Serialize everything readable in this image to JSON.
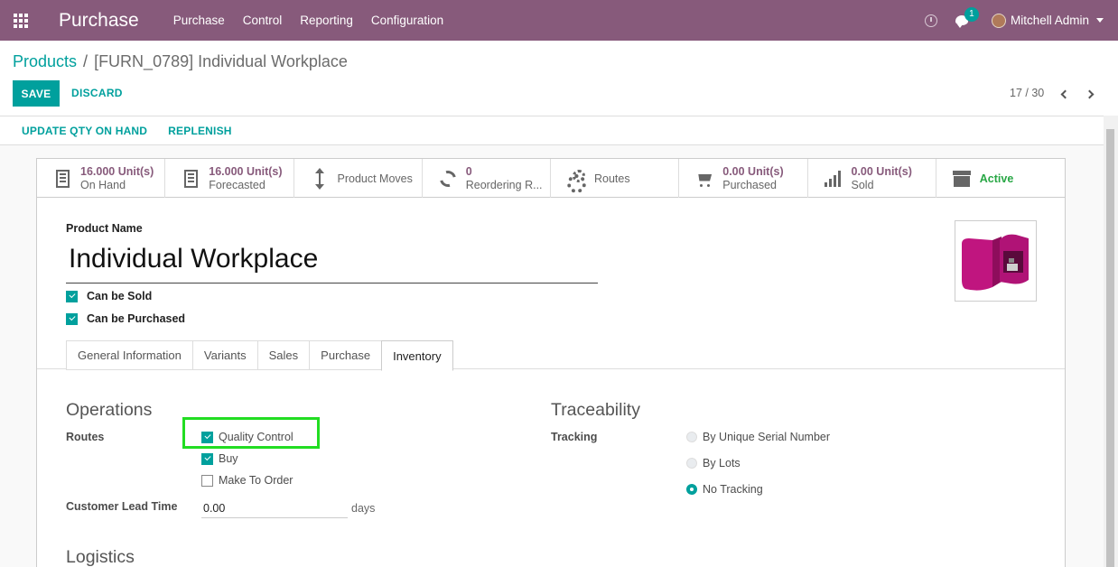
{
  "navbar": {
    "app_name": "Purchase",
    "menu": [
      "Purchase",
      "Control",
      "Reporting",
      "Configuration"
    ],
    "chat_count": "1",
    "user_name": "Mitchell Admin",
    "bg_color": "#875a7b"
  },
  "breadcrumb": {
    "parent": "Products",
    "separator": "/",
    "current": "[FURN_0789] Individual Workplace"
  },
  "actions": {
    "save": "SAVE",
    "discard": "DISCARD"
  },
  "pager": {
    "value": "17 / 30"
  },
  "header_buttons": {
    "update_qty": "UPDATE QTY ON HAND",
    "replenish": "REPLENISH"
  },
  "smart_buttons": {
    "on_hand": {
      "value": "16.000 Unit(s)",
      "label": "On Hand",
      "icon": "building-icon"
    },
    "forecasted": {
      "value": "16.000 Unit(s)",
      "label": "Forecasted",
      "icon": "building-icon"
    },
    "moves": {
      "label": "Product Moves",
      "icon": "arrows-v-icon"
    },
    "reordering": {
      "value": "0",
      "label": "Reordering R...",
      "icon": "refresh-icon"
    },
    "routes": {
      "label": "Routes",
      "icon": "gears-icon"
    },
    "purchased": {
      "value": "0.00 Unit(s)",
      "label": "Purchased",
      "icon": "cart-icon"
    },
    "sold": {
      "value": "0.00 Unit(s)",
      "label": "Sold",
      "icon": "signal-icon"
    },
    "active": {
      "label": "Active",
      "icon": "archive-icon"
    }
  },
  "product": {
    "name_label": "Product Name",
    "name": "Individual Workplace",
    "can_be_sold_label": "Can be Sold",
    "can_be_sold": true,
    "can_be_purchased_label": "Can be Purchased",
    "can_be_purchased": true
  },
  "tabs": [
    "General Information",
    "Variants",
    "Sales",
    "Purchase",
    "Inventory"
  ],
  "active_tab": "Inventory",
  "inventory": {
    "operations_title": "Operations",
    "routes_label": "Routes",
    "routes": [
      {
        "label": "Quality Control",
        "checked": true
      },
      {
        "label": "Buy",
        "checked": true
      },
      {
        "label": "Make To Order",
        "checked": false
      }
    ],
    "lead_time_label": "Customer Lead Time",
    "lead_time_value": "0.00",
    "lead_time_unit": "days",
    "traceability_title": "Traceability",
    "tracking_label": "Tracking",
    "tracking_options": [
      {
        "label": "By Unique Serial Number",
        "checked": false
      },
      {
        "label": "By Lots",
        "checked": false
      },
      {
        "label": "No Tracking",
        "checked": true
      }
    ],
    "logistics_title": "Logistics"
  },
  "colors": {
    "accent": "#00a09d",
    "brand": "#875a7b",
    "highlight": "#22dd22",
    "active": "#28a745"
  }
}
